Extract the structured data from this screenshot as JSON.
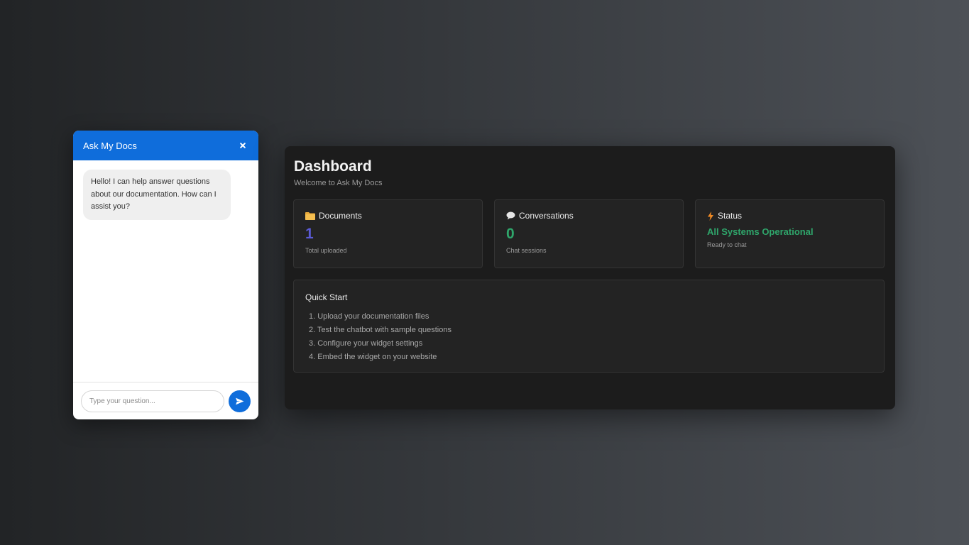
{
  "chat": {
    "title": "Ask My Docs",
    "greeting": "Hello! I can help answer questions about our documentation. How can I assist you?",
    "input_placeholder": "Type your question...",
    "input_value": "",
    "accent_color": "#0f6ddb",
    "icons": {
      "close": "close-icon",
      "send": "send-icon"
    }
  },
  "dashboard": {
    "title": "Dashboard",
    "subtitle": "Welcome to Ask My Docs",
    "cards": [
      {
        "icon": "folder-icon",
        "label": "Documents",
        "value": "1",
        "sub": "Total uploaded",
        "value_color": "#5b5bd6"
      },
      {
        "icon": "speech-bubble-icon",
        "label": "Conversations",
        "value": "0",
        "sub": "Chat sessions",
        "value_color": "#2fa66b"
      },
      {
        "icon": "lightning-icon",
        "label": "Status",
        "value": "All Systems Operational",
        "sub": "Ready to chat",
        "value_color": "#2fa66b"
      }
    ],
    "quick_start": {
      "title": "Quick Start",
      "steps": [
        "1. Upload your documentation files",
        "2. Test the chatbot with sample questions",
        "3. Configure your widget settings",
        "4. Embed the widget on your website"
      ]
    }
  }
}
